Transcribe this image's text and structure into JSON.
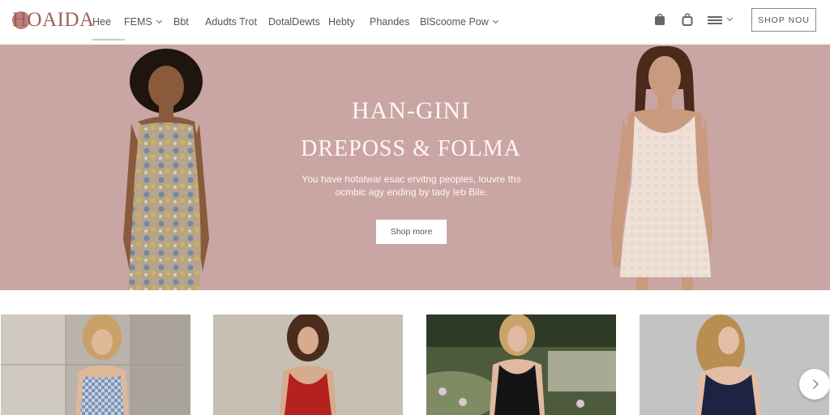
{
  "header": {
    "logo_text": "HOAIDA",
    "nav": [
      {
        "label": "Hee"
      },
      {
        "label": "FEMS"
      },
      {
        "label": "Bbt"
      },
      {
        "label": "Adudts Trot"
      },
      {
        "label": "DotalDewts"
      },
      {
        "label": "Hebty"
      },
      {
        "label": "Phandes"
      },
      {
        "label": "BlScoome Pow"
      }
    ],
    "cta_label": "SHOP NOU"
  },
  "hero": {
    "title_line1": "HAN-GINI",
    "title_line2": "DREPOSS & FOLMA",
    "subtitle": "You have hotalwar esac ervitng peoples, louvre ths ocmbic agy ending by tady leb Bile.",
    "button_label": "Shop more"
  },
  "colors": {
    "hero_bg": "#c9a6a3",
    "logo": "#a05d57",
    "accent": "#b8817b"
  }
}
